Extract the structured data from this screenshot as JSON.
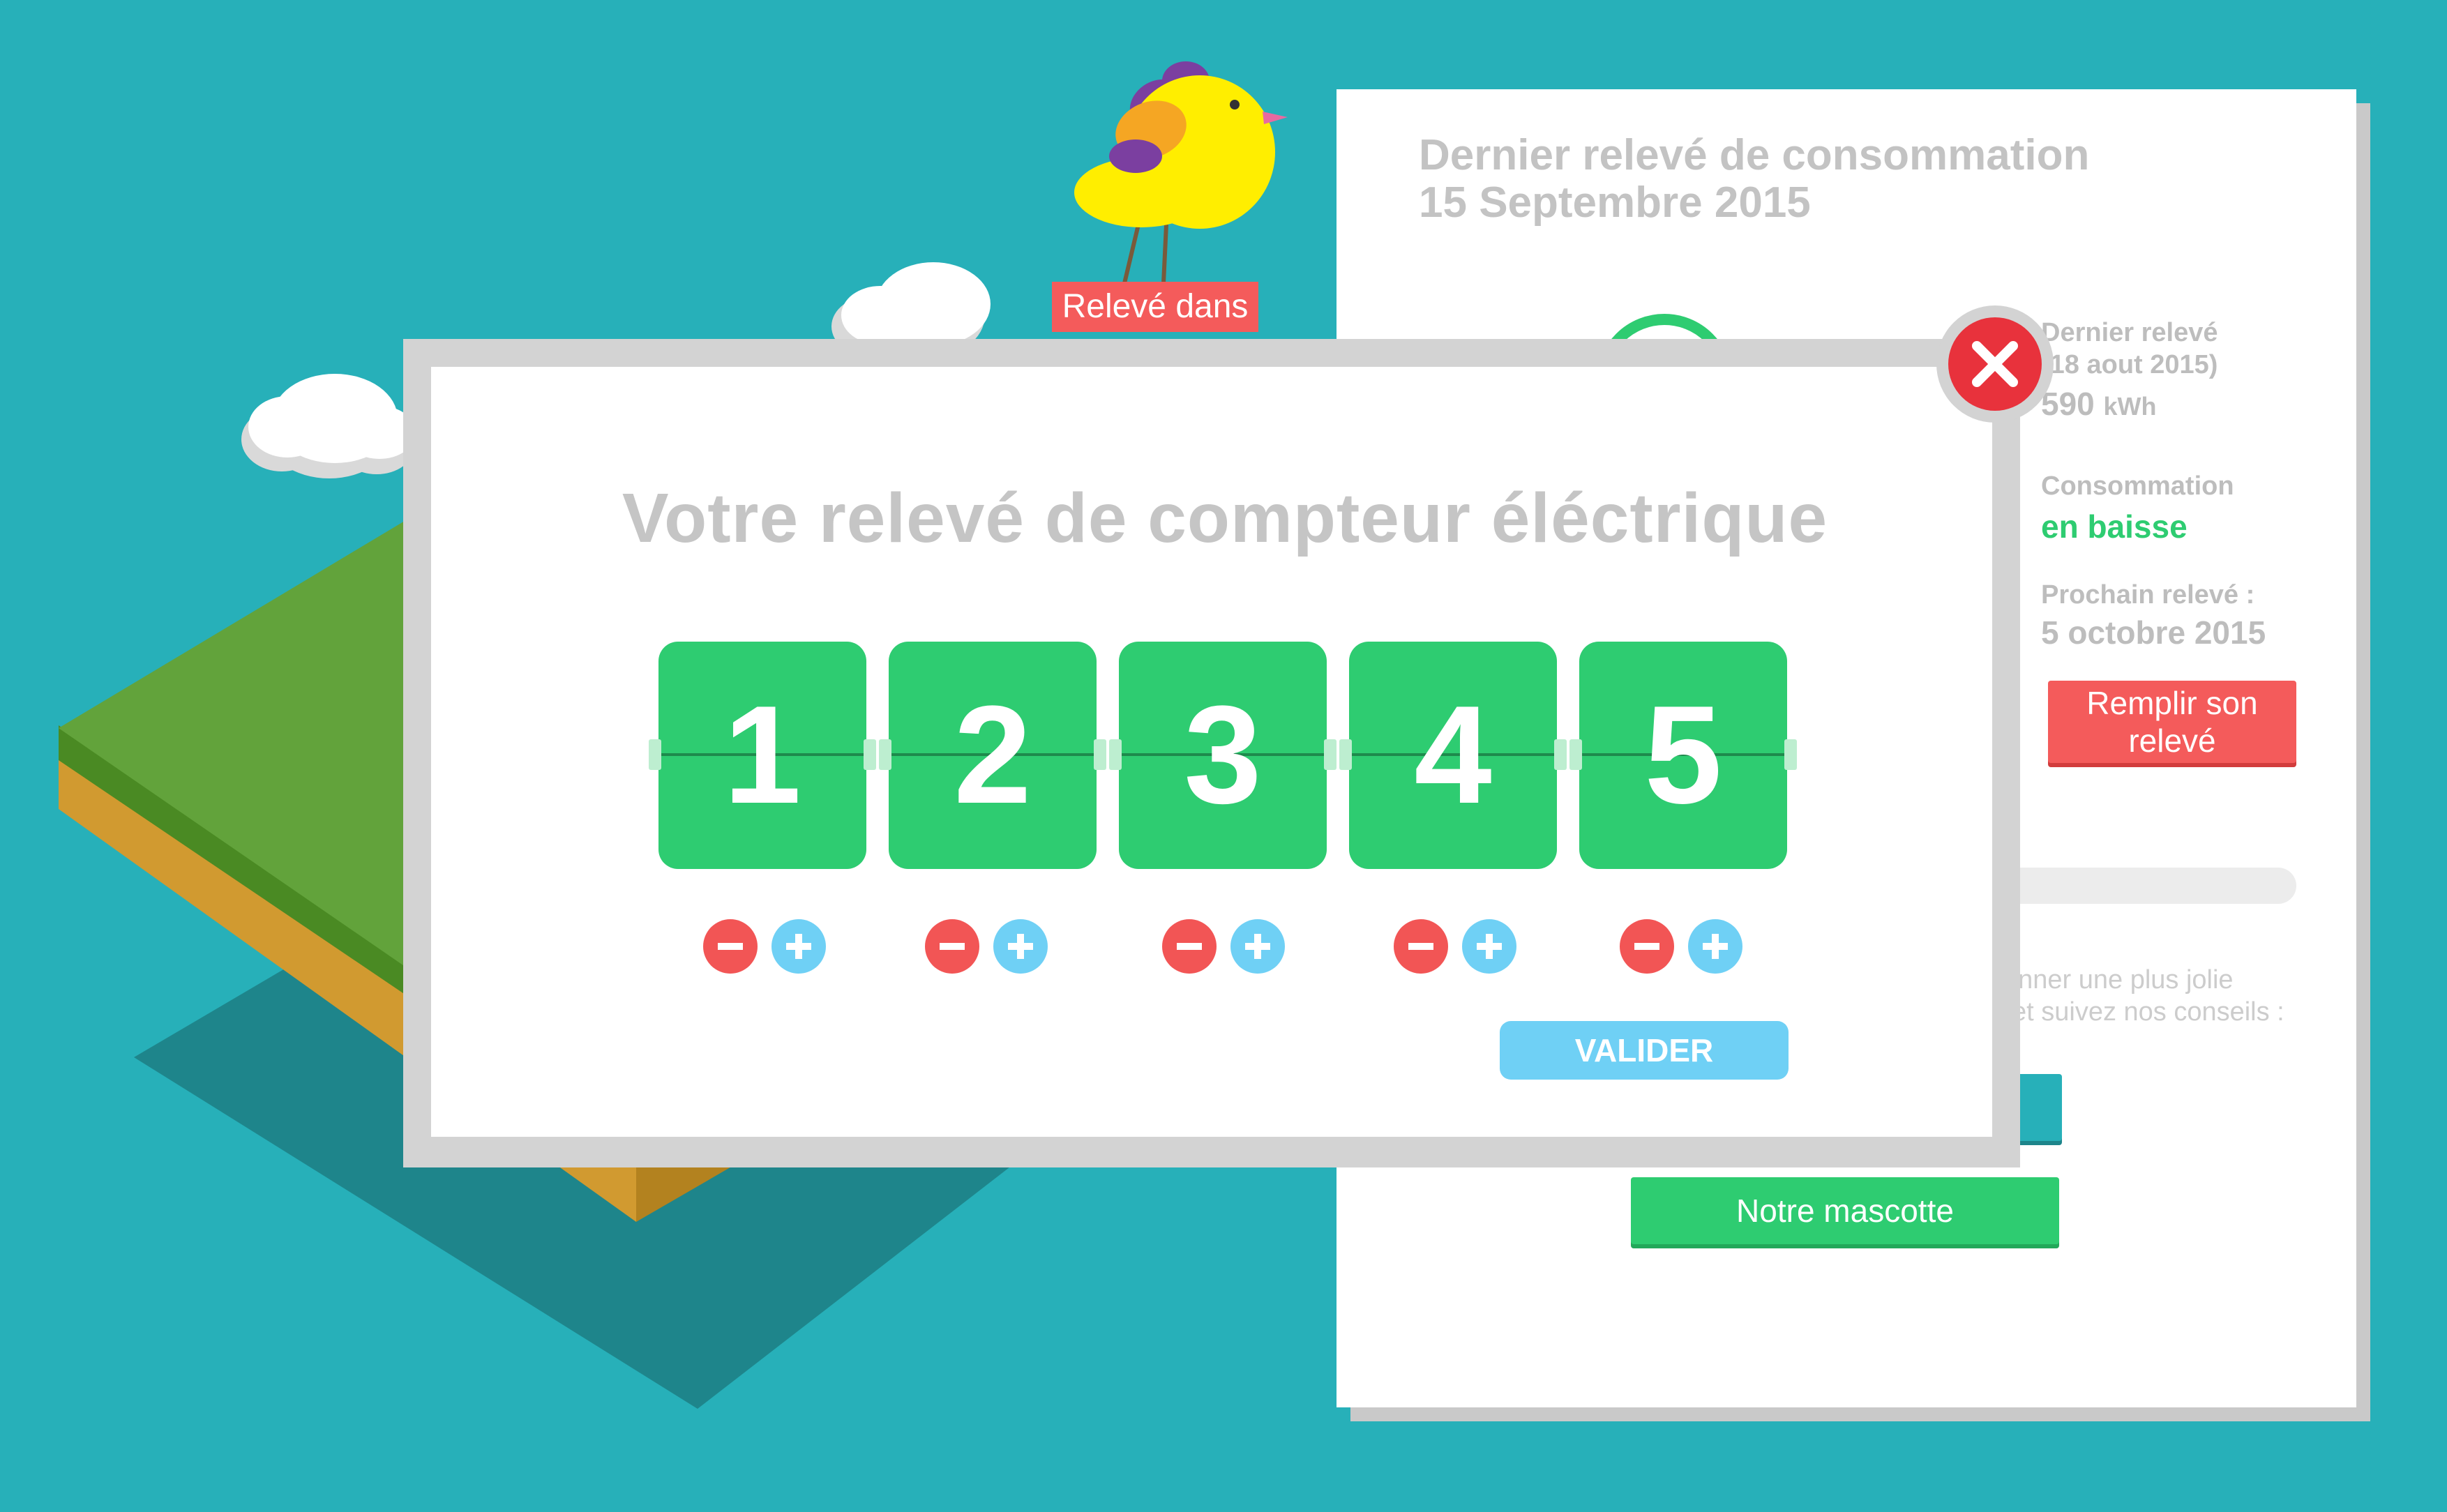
{
  "colors": {
    "background": "#27b0b9",
    "green": "#2ecc71",
    "red": "#f45b5b",
    "blue": "#6fd0f5",
    "grey_text": "#c5c5c5"
  },
  "panel": {
    "title": "Dernier relevé de consommation",
    "date": "15 Septembre 2015",
    "last_reading_label": "Dernier relevé",
    "last_reading_date": "(18 aout 2015)",
    "last_reading_value": "590",
    "last_reading_unit": "kWh",
    "trend_label": "Consommation",
    "trend_value": "en baisse",
    "next_label": "Prochain relevé :",
    "next_date": "5 octobre 2015",
    "fill_button": "Remplir son relevé",
    "tips_line_1": "onner une plus jolie",
    "tips_line_2": "et suivez nos conseils :",
    "mascot_button": "Notre mascotte"
  },
  "bird_badge": "Relevé dans",
  "modal": {
    "title": "Votre relevé de compteur éléctrique",
    "digits": [
      "1",
      "2",
      "3",
      "4",
      "5"
    ],
    "validate_button": "VALIDER"
  },
  "icons": [
    "close-icon",
    "minus-icon",
    "plus-icon",
    "bird-mascot-icon",
    "cloud-icon"
  ]
}
